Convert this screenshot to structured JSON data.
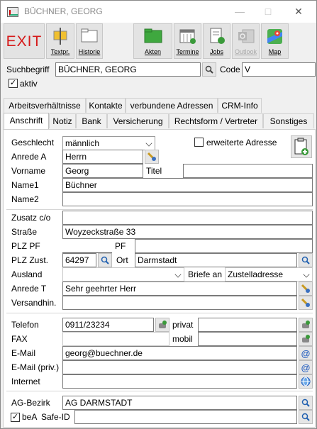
{
  "window": {
    "title": "BÜCHNER, GEORG"
  },
  "toolbar": {
    "exit": "EXIT",
    "textpr": "Textpr.",
    "historie": "Historie",
    "akten": "Akten",
    "termine": "Termine",
    "jobs": "Jobs",
    "outlook": "Outlook",
    "map": "Map"
  },
  "search": {
    "label": "Suchbegriff",
    "value": "BÜCHNER, GEORG",
    "code_label": "Code",
    "code_value": "V",
    "aktiv_label": "aktiv"
  },
  "tabs_top": [
    "Arbeitsverhältnisse",
    "Kontakte",
    "verbundene Adressen",
    "CRM-Info"
  ],
  "tabs_bottom": [
    "Anschrift",
    "Notiz",
    "Bank",
    "Versicherung",
    "Rechtsform / Vertreter",
    "Sonstiges"
  ],
  "form": {
    "geschlecht_label": "Geschlecht",
    "geschlecht_value": "männlich",
    "erweiterte_label": "erweiterte Adresse",
    "anrede_a_label": "Anrede A",
    "anrede_a_value": "Herrn",
    "vorname_label": "Vorname",
    "vorname_value": "Georg",
    "titel_label": "Titel",
    "titel_value": "",
    "name1_label": "Name1",
    "name1_value": "Büchner",
    "name2_label": "Name2",
    "name2_value": "",
    "zusatz_label": "Zusatz c/o",
    "zusatz_value": "",
    "strasse_label": "Straße",
    "strasse_value": "Woyzeckstraße 33",
    "plzpf_label": "PLZ PF",
    "plzpf_value": "",
    "pf_label": "PF",
    "pf_value": "",
    "plzzust_label": "PLZ Zust.",
    "plzzust_value": "64297",
    "ort_label": "Ort",
    "ort_value": "Darmstadt",
    "ausland_label": "Ausland",
    "ausland_value": "",
    "briefe_label": "Briefe an",
    "briefe_value": "Zustelladresse",
    "anrede_t_label": "Anrede T",
    "anrede_t_value": "Sehr geehrter Herr",
    "versandhin_label": "Versandhin.",
    "versandhin_value": "",
    "telefon_label": "Telefon",
    "telefon_value": "0911/23234",
    "privat_label": "privat",
    "privat_value": "",
    "fax_label": "FAX",
    "fax_value": "",
    "mobil_label": "mobil",
    "mobil_value": "",
    "email_label": "E-Mail",
    "email_value": "georg@buechner.de",
    "email_priv_label": "E-Mail (priv.)",
    "email_priv_value": "",
    "internet_label": "Internet",
    "internet_value": "",
    "agbezirk_label": "AG-Bezirk",
    "agbezirk_value": "AG DARMSTADT",
    "bea_label": "beA",
    "safeid_label": "Safe-ID",
    "safeid_value": ""
  }
}
